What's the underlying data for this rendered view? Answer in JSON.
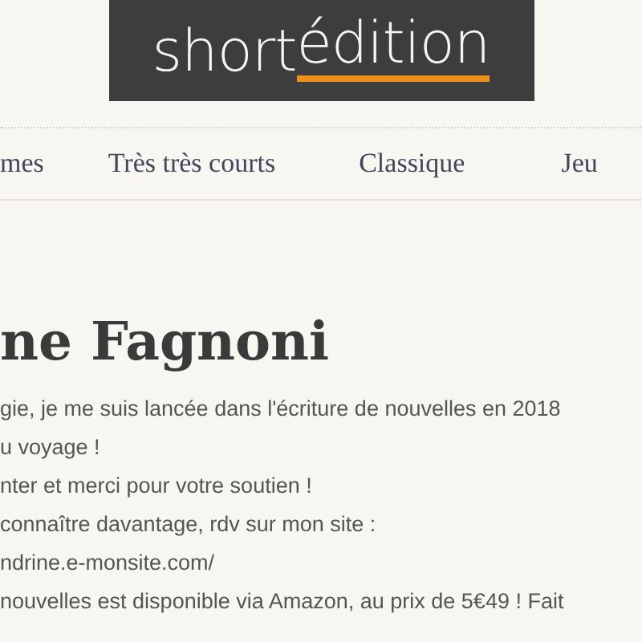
{
  "logo": {
    "word_1": "short",
    "word_2": "édition"
  },
  "nav": {
    "items": [
      {
        "label": "mes"
      },
      {
        "label": "Très très courts"
      },
      {
        "label": "Classique"
      },
      {
        "label": "Jeu"
      }
    ]
  },
  "author": {
    "name": "ne Fagnoni"
  },
  "bio": {
    "lines": [
      "gie, je me suis lancée dans l'écriture de nouvelles en 2018",
      "u voyage !",
      "nter et merci pour votre soutien !",
      "connaître davantage, rdv sur mon site :",
      "ndrine.e-monsite.com/",
      "nouvelles est disponible via Amazon, au prix de 5€49 ! Fait"
    ]
  }
}
